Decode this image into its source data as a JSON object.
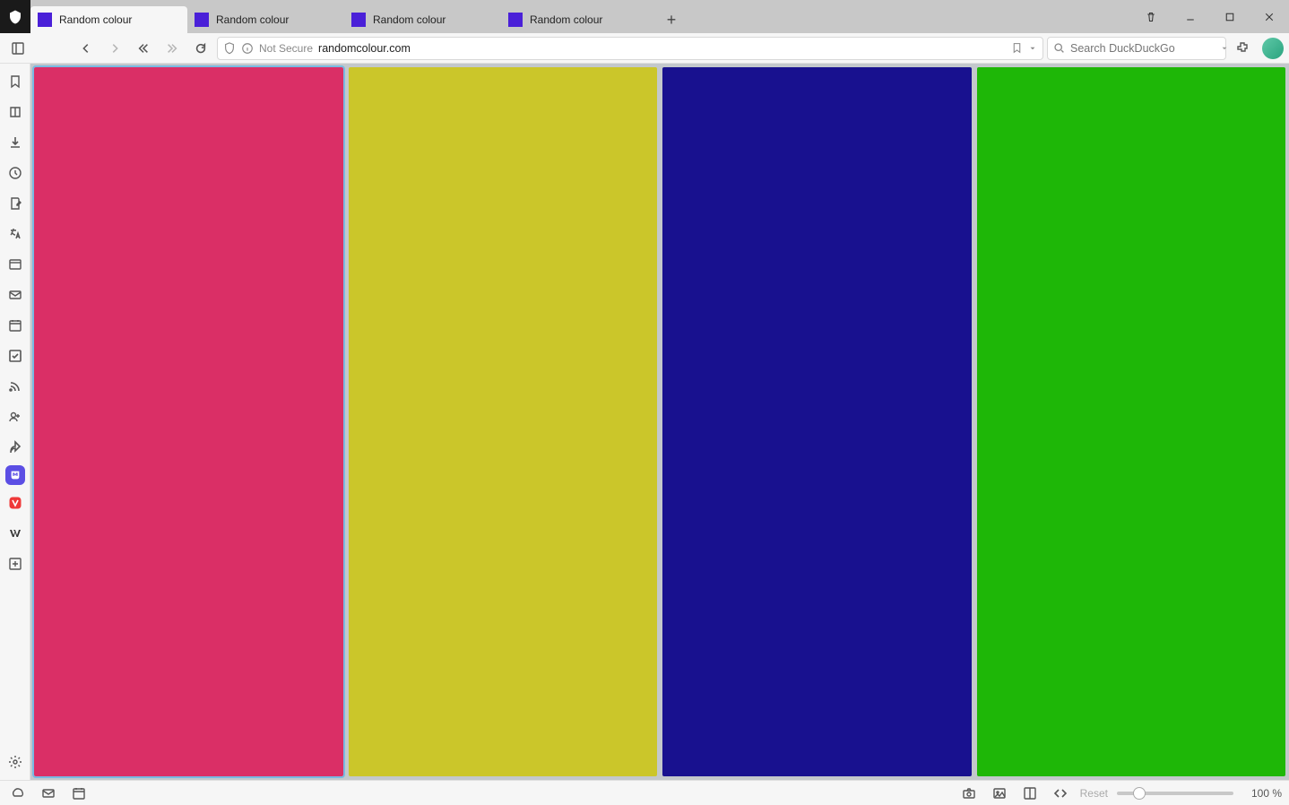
{
  "tabs": [
    {
      "label": "Random colour",
      "favicon": "#4a20d8",
      "active": true
    },
    {
      "label": "Random colour",
      "favicon": "#4a20d8",
      "active": false
    },
    {
      "label": "Random colour",
      "favicon": "#4a20d8",
      "active": false
    },
    {
      "label": "Random colour",
      "favicon": "#4a20d8",
      "active": false
    }
  ],
  "address": {
    "not_secure": "Not Secure",
    "url": "randomcolour.com"
  },
  "search": {
    "placeholder": "Search DuckDuckGo"
  },
  "panes": [
    {
      "color": "#da2f66",
      "active": true
    },
    {
      "color": "#cbc62a",
      "active": false
    },
    {
      "color": "#18118f",
      "active": false
    },
    {
      "color": "#1eb707",
      "active": false
    }
  ],
  "status": {
    "reset": "Reset",
    "zoom": "100 %"
  },
  "panel_icons": [
    "bookmarks-icon",
    "reading-list-icon",
    "downloads-icon",
    "history-icon",
    "notes-icon",
    "translate-icon",
    "window-panel-icon",
    "mail-icon",
    "calendar-icon",
    "tasks-icon",
    "feeds-icon",
    "contacts-icon",
    "sessions-icon",
    "mastodon-icon",
    "vivaldi-icon",
    "wikipedia-icon",
    "add-panel-icon"
  ]
}
